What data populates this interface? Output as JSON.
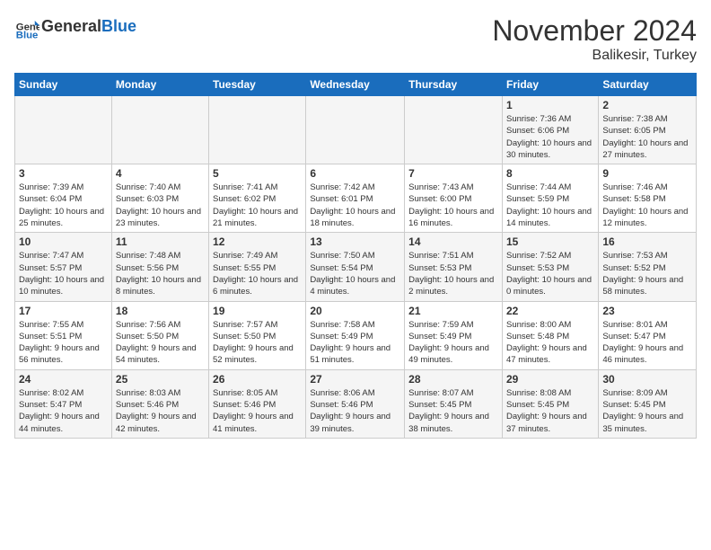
{
  "header": {
    "logo_general": "General",
    "logo_blue": "Blue",
    "month": "November 2024",
    "location": "Balikesir, Turkey"
  },
  "days_of_week": [
    "Sunday",
    "Monday",
    "Tuesday",
    "Wednesday",
    "Thursday",
    "Friday",
    "Saturday"
  ],
  "weeks": [
    [
      {
        "day": "",
        "info": ""
      },
      {
        "day": "",
        "info": ""
      },
      {
        "day": "",
        "info": ""
      },
      {
        "day": "",
        "info": ""
      },
      {
        "day": "",
        "info": ""
      },
      {
        "day": "1",
        "info": "Sunrise: 7:36 AM\nSunset: 6:06 PM\nDaylight: 10 hours and 30 minutes."
      },
      {
        "day": "2",
        "info": "Sunrise: 7:38 AM\nSunset: 6:05 PM\nDaylight: 10 hours and 27 minutes."
      }
    ],
    [
      {
        "day": "3",
        "info": "Sunrise: 7:39 AM\nSunset: 6:04 PM\nDaylight: 10 hours and 25 minutes."
      },
      {
        "day": "4",
        "info": "Sunrise: 7:40 AM\nSunset: 6:03 PM\nDaylight: 10 hours and 23 minutes."
      },
      {
        "day": "5",
        "info": "Sunrise: 7:41 AM\nSunset: 6:02 PM\nDaylight: 10 hours and 21 minutes."
      },
      {
        "day": "6",
        "info": "Sunrise: 7:42 AM\nSunset: 6:01 PM\nDaylight: 10 hours and 18 minutes."
      },
      {
        "day": "7",
        "info": "Sunrise: 7:43 AM\nSunset: 6:00 PM\nDaylight: 10 hours and 16 minutes."
      },
      {
        "day": "8",
        "info": "Sunrise: 7:44 AM\nSunset: 5:59 PM\nDaylight: 10 hours and 14 minutes."
      },
      {
        "day": "9",
        "info": "Sunrise: 7:46 AM\nSunset: 5:58 PM\nDaylight: 10 hours and 12 minutes."
      }
    ],
    [
      {
        "day": "10",
        "info": "Sunrise: 7:47 AM\nSunset: 5:57 PM\nDaylight: 10 hours and 10 minutes."
      },
      {
        "day": "11",
        "info": "Sunrise: 7:48 AM\nSunset: 5:56 PM\nDaylight: 10 hours and 8 minutes."
      },
      {
        "day": "12",
        "info": "Sunrise: 7:49 AM\nSunset: 5:55 PM\nDaylight: 10 hours and 6 minutes."
      },
      {
        "day": "13",
        "info": "Sunrise: 7:50 AM\nSunset: 5:54 PM\nDaylight: 10 hours and 4 minutes."
      },
      {
        "day": "14",
        "info": "Sunrise: 7:51 AM\nSunset: 5:53 PM\nDaylight: 10 hours and 2 minutes."
      },
      {
        "day": "15",
        "info": "Sunrise: 7:52 AM\nSunset: 5:53 PM\nDaylight: 10 hours and 0 minutes."
      },
      {
        "day": "16",
        "info": "Sunrise: 7:53 AM\nSunset: 5:52 PM\nDaylight: 9 hours and 58 minutes."
      }
    ],
    [
      {
        "day": "17",
        "info": "Sunrise: 7:55 AM\nSunset: 5:51 PM\nDaylight: 9 hours and 56 minutes."
      },
      {
        "day": "18",
        "info": "Sunrise: 7:56 AM\nSunset: 5:50 PM\nDaylight: 9 hours and 54 minutes."
      },
      {
        "day": "19",
        "info": "Sunrise: 7:57 AM\nSunset: 5:50 PM\nDaylight: 9 hours and 52 minutes."
      },
      {
        "day": "20",
        "info": "Sunrise: 7:58 AM\nSunset: 5:49 PM\nDaylight: 9 hours and 51 minutes."
      },
      {
        "day": "21",
        "info": "Sunrise: 7:59 AM\nSunset: 5:49 PM\nDaylight: 9 hours and 49 minutes."
      },
      {
        "day": "22",
        "info": "Sunrise: 8:00 AM\nSunset: 5:48 PM\nDaylight: 9 hours and 47 minutes."
      },
      {
        "day": "23",
        "info": "Sunrise: 8:01 AM\nSunset: 5:47 PM\nDaylight: 9 hours and 46 minutes."
      }
    ],
    [
      {
        "day": "24",
        "info": "Sunrise: 8:02 AM\nSunset: 5:47 PM\nDaylight: 9 hours and 44 minutes."
      },
      {
        "day": "25",
        "info": "Sunrise: 8:03 AM\nSunset: 5:46 PM\nDaylight: 9 hours and 42 minutes."
      },
      {
        "day": "26",
        "info": "Sunrise: 8:05 AM\nSunset: 5:46 PM\nDaylight: 9 hours and 41 minutes."
      },
      {
        "day": "27",
        "info": "Sunrise: 8:06 AM\nSunset: 5:46 PM\nDaylight: 9 hours and 39 minutes."
      },
      {
        "day": "28",
        "info": "Sunrise: 8:07 AM\nSunset: 5:45 PM\nDaylight: 9 hours and 38 minutes."
      },
      {
        "day": "29",
        "info": "Sunrise: 8:08 AM\nSunset: 5:45 PM\nDaylight: 9 hours and 37 minutes."
      },
      {
        "day": "30",
        "info": "Sunrise: 8:09 AM\nSunset: 5:45 PM\nDaylight: 9 hours and 35 minutes."
      }
    ]
  ]
}
